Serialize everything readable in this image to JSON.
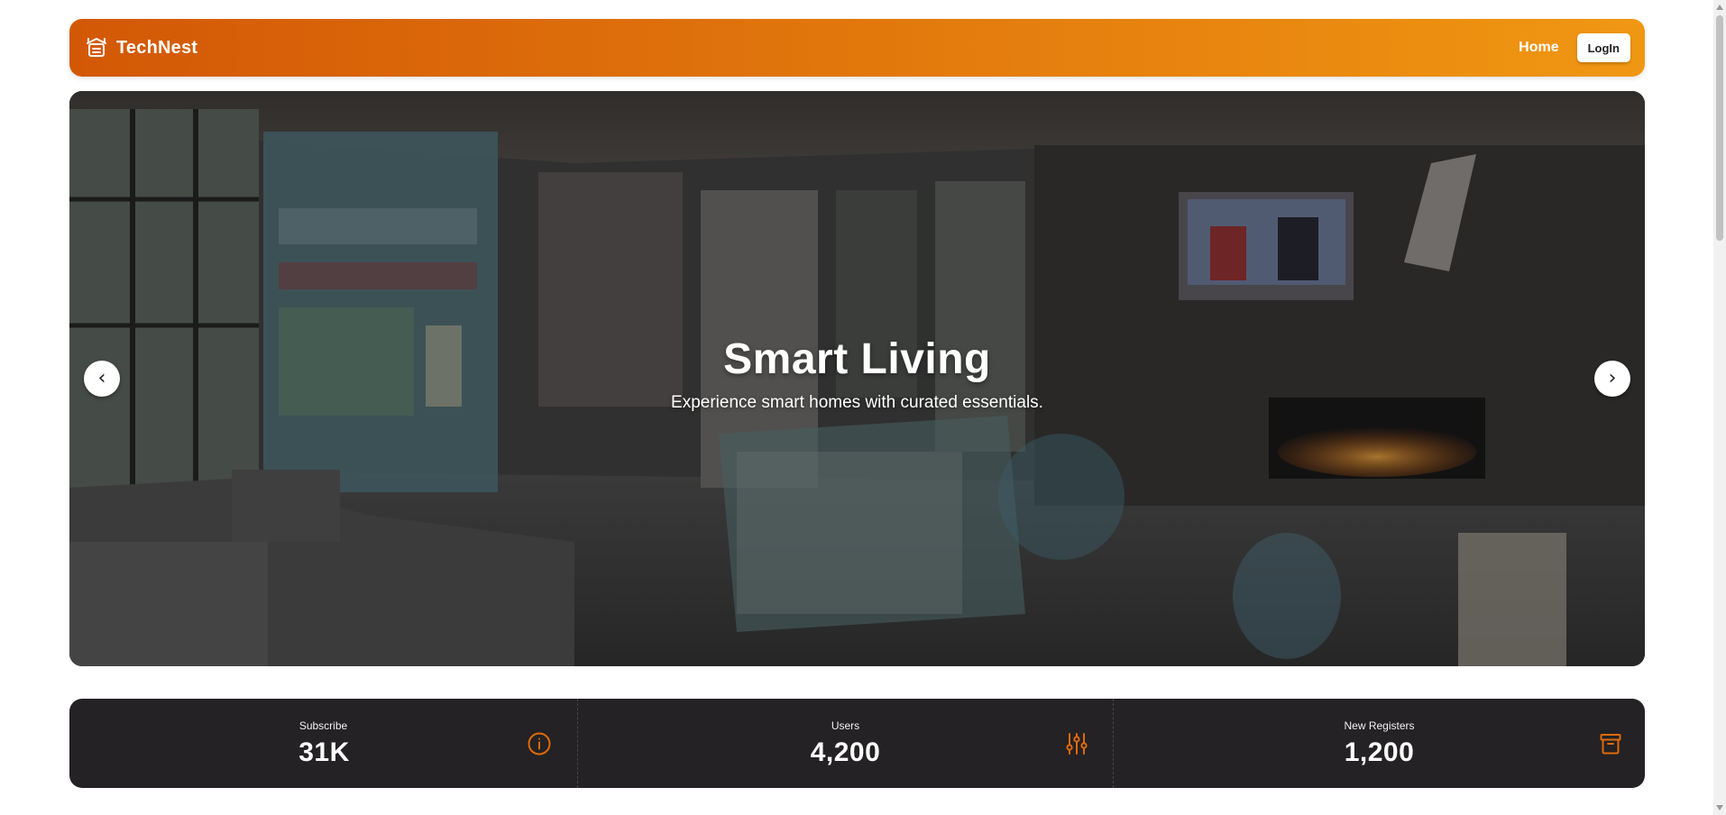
{
  "navbar": {
    "brand": "TechNest",
    "brand_icon": "smart-home-icon",
    "home_label": "Home",
    "login_label": "LogIn"
  },
  "hero": {
    "title": "Smart Living",
    "subtitle": "Experience smart homes with curated essentials.",
    "prev_label": "‹",
    "next_label": "›"
  },
  "stats": [
    {
      "label": "Subscribe",
      "value": "31K",
      "icon": "info-icon"
    },
    {
      "label": "Users",
      "value": "4,200",
      "icon": "sliders-icon"
    },
    {
      "label": "New Registers",
      "value": "1,200",
      "icon": "archive-icon"
    }
  ],
  "colors": {
    "accent": "#e06a0a",
    "nav_start": "#d35806",
    "nav_end": "#f09712",
    "stats_bg": "#242224"
  }
}
